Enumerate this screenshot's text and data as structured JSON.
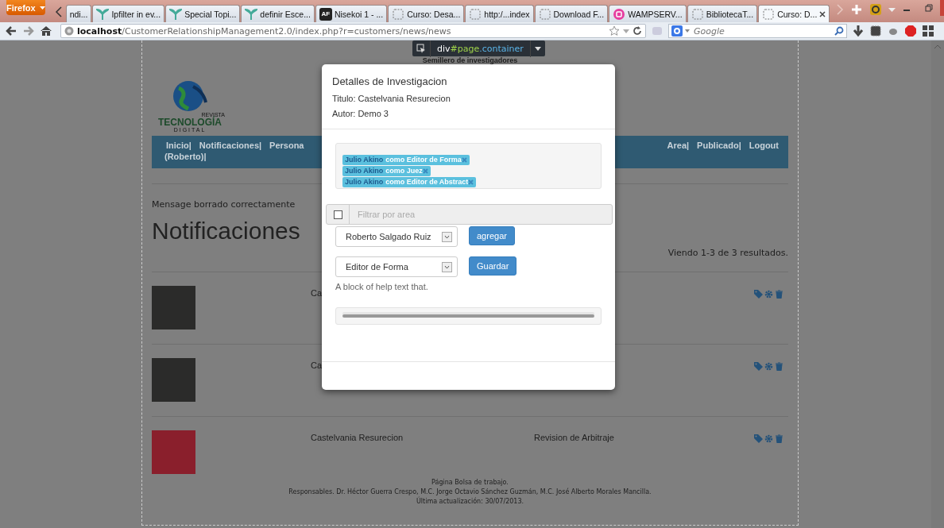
{
  "browser": {
    "menu_button": "Firefox",
    "tabs": [
      {
        "title": "ndi...",
        "kind": "plain",
        "selected": false
      },
      {
        "title": "Ipfilter in ev...",
        "kind": "leaf",
        "selected": false
      },
      {
        "title": "Special Topi...",
        "kind": "leaf",
        "selected": false
      },
      {
        "title": "definir Esce...",
        "kind": "leaf",
        "selected": false
      },
      {
        "title": "Nisekoi 1 - ...",
        "kind": "badge",
        "badge_text": "AF",
        "selected": false
      },
      {
        "title": "Curso: Desa...",
        "kind": "blank",
        "selected": false
      },
      {
        "title": "http:/...index",
        "kind": "blank",
        "selected": false
      },
      {
        "title": "Download F...",
        "kind": "blank",
        "selected": false
      },
      {
        "title": "WAMPSERV...",
        "kind": "wamp",
        "selected": false
      },
      {
        "title": "BibliotecaT...",
        "kind": "blank",
        "selected": false
      },
      {
        "title": "Curso: D...",
        "kind": "blank",
        "selected": true
      }
    ],
    "address": {
      "host": "localhost",
      "path": "/CustomerRelationshipManagement2.0/index.php?r=customers/news/news"
    },
    "search": {
      "placeholder": "Google"
    }
  },
  "inspector_tooltip": {
    "selector_parts": [
      "div",
      "#page",
      ".container"
    ]
  },
  "page": {
    "site_title": "Semillero de investigadores",
    "logo": {
      "kicker": "REVISTA",
      "name": "TECNOLOGÍA",
      "sub": "DIGITAL"
    },
    "nav": {
      "left": [
        "Inicio|",
        "Notificaciones|",
        "Persona"
      ],
      "right": [
        "Area|",
        "Publicado|",
        "Logout"
      ],
      "second_line": "(Roberto)|"
    },
    "flash": "Mensage borrado correctamente",
    "heading": "Notificaciones",
    "summary": "Viendo 1-3 de 3 resultados.",
    "rows": [
      {
        "kind": "dark",
        "title": "Ca"
      },
      {
        "kind": "dark",
        "title": "Ca"
      },
      {
        "kind": "red",
        "title": "Castelvania Resurecion",
        "status": "Revision de Arbitraje"
      }
    ],
    "footer": [
      "Página Bolsa de trabajo.",
      "Responsables. Dr. Héctor Guerra Crespo, M.C. Jorge Octavio Sánchez Guzmán, M.C. José Alberto Morales Mancilla.",
      "Última actualización: 30/07/2013."
    ]
  },
  "modal": {
    "title": "Detalles de Investigacion",
    "fields": [
      "Titulo: Castelvania Resurecion",
      "Autor: Demo 3"
    ],
    "assignments": [
      {
        "name": "Julio Akino",
        "role": "como Editor de Forma"
      },
      {
        "name": "Julio Akino",
        "role": "como Juez"
      },
      {
        "name": "Julio Akino",
        "role": "como Editor de Abstract"
      }
    ],
    "filter": {
      "checked": false,
      "placeholder": "Filtrar por area"
    },
    "reviewer_select": {
      "value": "Roberto Salgado Ruiz"
    },
    "add_button": "agregar",
    "role_select": {
      "value": "Editor de Forma"
    },
    "save_button": "Guardar",
    "help_text": "A block of help text that.",
    "progress": {
      "level": 1
    }
  }
}
